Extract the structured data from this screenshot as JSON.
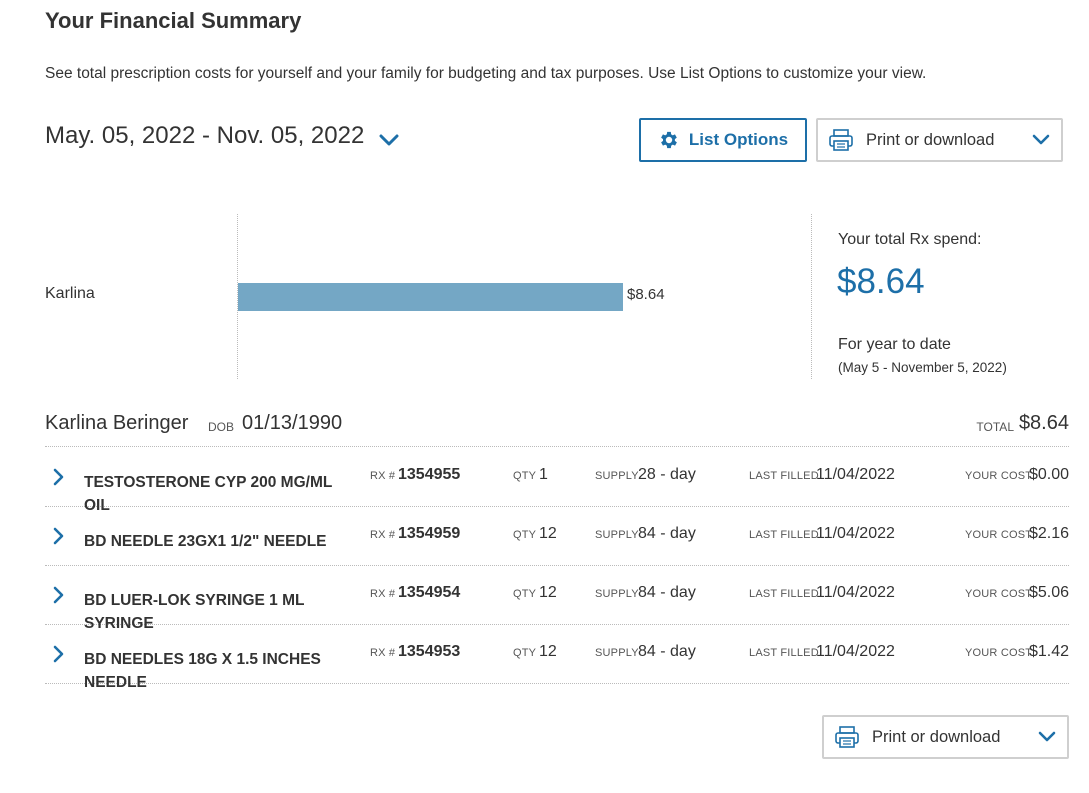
{
  "header": {
    "title": "Your Financial Summary",
    "description": "See total prescription costs for yourself and your family for budgeting and tax purposes. Use List Options to customize your view."
  },
  "controls": {
    "date_range": "May. 05, 2022 - Nov. 05, 2022",
    "list_options_label": "List Options",
    "print_label": "Print or download"
  },
  "chart_data": {
    "type": "bar",
    "orientation": "horizontal",
    "categories": [
      "Karlina"
    ],
    "values": [
      8.64
    ],
    "value_labels": [
      "$8.64"
    ],
    "bar_color": "#74a7c5"
  },
  "summary": {
    "total_label": "Your total Rx spend:",
    "total_amount": "$8.64",
    "ytd_label": "For year to date",
    "ytd_range": "(May 5 - November 5, 2022)"
  },
  "member": {
    "name": "Karlina Beringer",
    "dob_label": "DOB",
    "dob": "01/13/1990",
    "total_label": "TOTAL",
    "total": "$8.64"
  },
  "field_labels": {
    "rx": "RX #",
    "qty": "QTY",
    "supply": "SUPPLY",
    "last_filled": "LAST FILLED",
    "your_cost": "YOUR COST"
  },
  "prescriptions": [
    {
      "name": "TESTOSTERONE CYP 200 MG/ML OIL",
      "rx": "1354955",
      "qty": "1",
      "supply": "28 - day",
      "last_filled": "11/04/2022",
      "cost": "$0.00"
    },
    {
      "name": "BD NEEDLE 23GX1 1/2\" NEEDLE",
      "rx": "1354959",
      "qty": "12",
      "supply": "84 - day",
      "last_filled": "11/04/2022",
      "cost": "$2.16"
    },
    {
      "name": "BD LUER-LOK SYRINGE 1 ML SYRINGE",
      "rx": "1354954",
      "qty": "12",
      "supply": "84 - day",
      "last_filled": "11/04/2022",
      "cost": "$5.06"
    },
    {
      "name": "BD NEEDLES 18G X 1.5 INCHES NEEDLE",
      "rx": "1354953",
      "qty": "12",
      "supply": "84 - day",
      "last_filled": "11/04/2022",
      "cost": "$1.42"
    }
  ],
  "colors": {
    "accent": "#1d6fa8",
    "bar": "#74a7c5",
    "text": "#333333"
  },
  "icons": {
    "date_toggle": "chevron-down-icon",
    "list_options": "gear-icon",
    "print": "printer-icon",
    "row_expand": "chevron-right-icon"
  }
}
